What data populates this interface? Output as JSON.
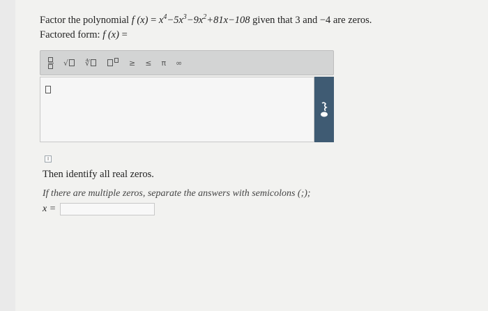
{
  "question": {
    "prefix": "Factor the polynomial",
    "fx": "f (x)",
    "eq": "=",
    "poly_x4": "x",
    "poly_exp4": "4",
    "poly_t1": "−5x",
    "poly_exp3": "3",
    "poly_t2": "−9x",
    "poly_exp2": "2",
    "poly_t3": "+81x−108",
    "given": "given that 3  and −4  are zeros.",
    "factored_label": "Factored form:",
    "factored_fx": "f (x)",
    "factored_eq": "="
  },
  "toolbar": {
    "sqrt": "√",
    "nthroot": "∜",
    "ge": "≥",
    "le": "≤",
    "pi": "π",
    "inf": "∞"
  },
  "parts": {
    "check_icon": "I",
    "identify": "Then identify all real zeros.",
    "hint": "If there are multiple zeros, separate the answers with semicolons (;);",
    "x_label": "x =",
    "x_value": ""
  }
}
